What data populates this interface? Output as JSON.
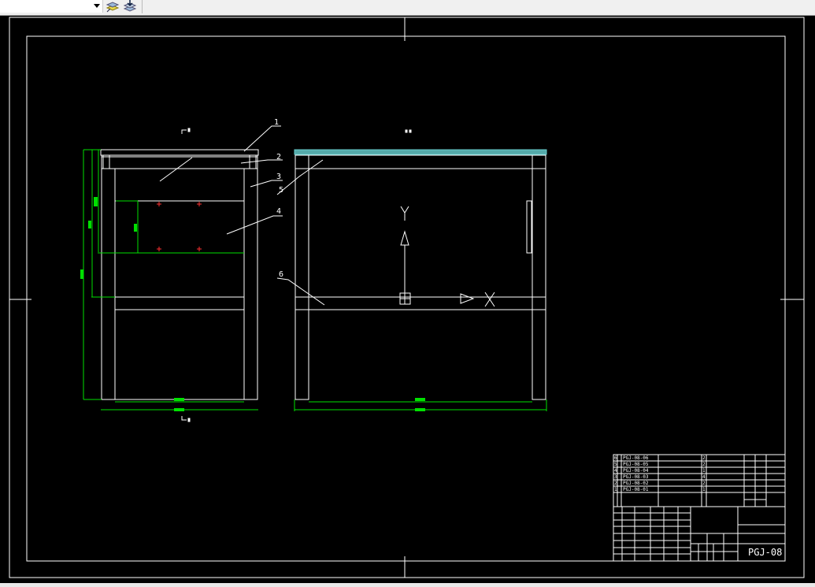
{
  "toolbar": {
    "layer_dropdown_value": "",
    "buttons": [
      "layer-states-icon",
      "layer-previous-icon"
    ]
  },
  "drawing": {
    "balloons": [
      "1",
      "2",
      "3",
      "4",
      "5",
      "6"
    ],
    "ucs": {
      "x_label": "X",
      "y_label": "Y"
    },
    "colors": {
      "geometry": "#ffffff",
      "dimension": "#00ff00",
      "hatch": "#66cccc",
      "center_mark": "#ff3030"
    }
  },
  "title_block": {
    "drawing_number": "PGJ-08",
    "parts": [
      {
        "no": "6",
        "code": "PGJ-08-06",
        "qty": "2"
      },
      {
        "no": "5",
        "code": "PGJ-08-05",
        "qty": "2"
      },
      {
        "no": "4",
        "code": "PGJ-08-04",
        "qty": "1"
      },
      {
        "no": "3",
        "code": "PGJ-08-03",
        "qty": "4"
      },
      {
        "no": "2",
        "code": "PGJ-08-02",
        "qty": "2"
      },
      {
        "no": "1",
        "code": "PGJ-08-01",
        "qty": "1"
      }
    ]
  }
}
